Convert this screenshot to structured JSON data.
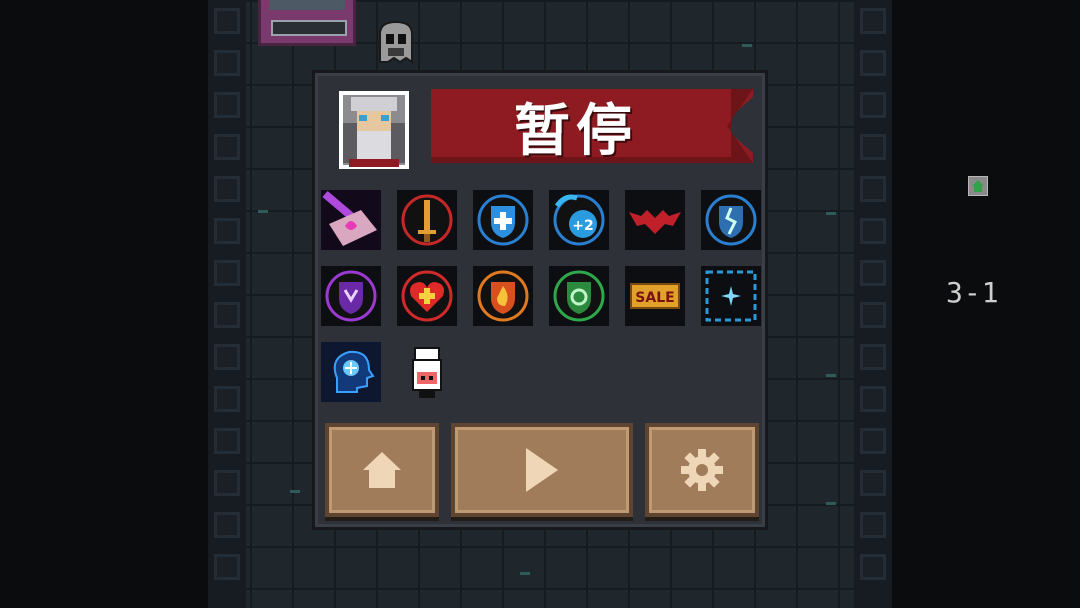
{
  "pause_menu": {
    "title": "暂停",
    "skills": [
      {
        "name": "pink-map-icon"
      },
      {
        "name": "sword-icon"
      },
      {
        "name": "shield-cross-icon"
      },
      {
        "name": "water-plus-two-icon"
      },
      {
        "name": "bat-icon"
      },
      {
        "name": "cracked-shield-icon"
      },
      {
        "name": "purple-shield-icon"
      },
      {
        "name": "heart-plus-icon"
      },
      {
        "name": "fire-shield-icon"
      },
      {
        "name": "green-shield-icon"
      },
      {
        "name": "sale-icon",
        "label": "SALE"
      },
      {
        "name": "sparkle-frame-icon"
      },
      {
        "name": "brain-head-icon"
      },
      {
        "name": "chef-pig-icon"
      }
    ],
    "buttons": {
      "home": "home-icon",
      "resume": "play-icon",
      "settings": "gear-icon"
    },
    "water_bonus": "+2"
  },
  "hud": {
    "level": "3-1",
    "minimap_room": "home-icon"
  },
  "colors": {
    "banner_red": "#8e1b22",
    "button_brown": "#a17c5a",
    "panel_bg": "#2e3138"
  }
}
